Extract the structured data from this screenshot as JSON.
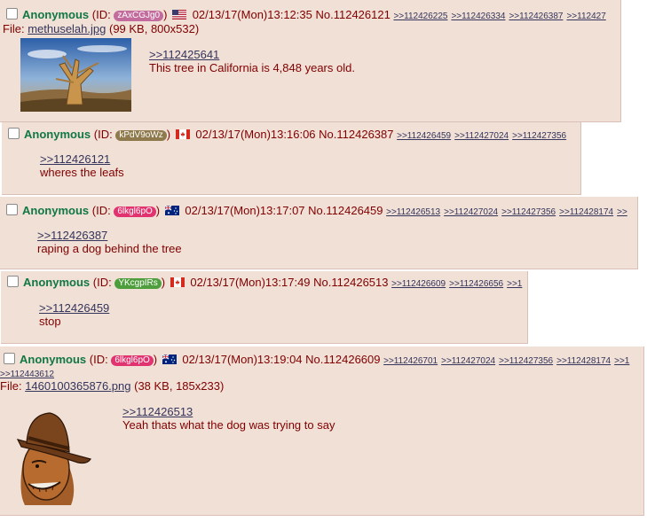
{
  "colors": {
    "post_bg": "#f0e0d6",
    "name": "#117743",
    "link": "#34345c",
    "text": "#800000",
    "page_bg": "#ffffff"
  },
  "posts": [
    {
      "name": "Anonymous",
      "id_prefix": "(ID: ",
      "id": "zAxCGJg0",
      "id_color": "#c26b9c",
      "id_suffix": ")",
      "flag_icon": "us-flag-icon",
      "datetime": "02/13/17(Mon)13:12:35",
      "postno": "No.112426121",
      "backlinks": [
        ">>112426225",
        ">>112426334",
        ">>112426387",
        ">>112427"
      ],
      "file_prefix": "File:",
      "file_name": "methuselah.jpg",
      "file_info": "(99 KB, 800x532)",
      "quote": ">>112425641",
      "text": "This tree in California is 4,848 years old.",
      "thumb_icon": "bristlecone-pine-photo"
    },
    {
      "name": "Anonymous",
      "id_prefix": "(ID: ",
      "id": "kPdV9oWz",
      "id_color": "#8e7a4c",
      "id_suffix": ")",
      "flag_icon": "canada-flag-icon",
      "datetime": "02/13/17(Mon)13:16:06",
      "postno": "No.112426387",
      "backlinks": [
        ">>112426459",
        ">>112427024",
        ">>112427356"
      ],
      "quote": ">>112426121",
      "text": "wheres the leafs"
    },
    {
      "name": "Anonymous",
      "id_prefix": "(ID: ",
      "id": "6lkgl6pO",
      "id_color": "#e0336f",
      "id_suffix": ")",
      "flag_icon": "australia-flag-icon",
      "datetime": "02/13/17(Mon)13:17:07",
      "postno": "No.112426459",
      "backlinks": [
        ">>112426513",
        ">>112427024",
        ">>112427356",
        ">>112428174",
        ">>"
      ],
      "quote": ">>112426387",
      "text": "raping a dog behind the tree"
    },
    {
      "name": "Anonymous",
      "id_prefix": "(ID: ",
      "id": "YKcgpIRs",
      "id_color": "#4f9e3d",
      "id_suffix": ")",
      "flag_icon": "canada-flag-icon",
      "datetime": "02/13/17(Mon)13:17:49",
      "postno": "No.112426513",
      "backlinks": [
        ">>112426609",
        ">>112426656",
        ">>1"
      ],
      "quote": ">>112426459",
      "text": "stop"
    },
    {
      "name": "Anonymous",
      "id_prefix": "(ID: ",
      "id": "6lkgl6pO",
      "id_color": "#e0336f",
      "id_suffix": ")",
      "flag_icon": "australia-flag-icon",
      "datetime": "02/13/17(Mon)13:19:04",
      "postno": "No.112426609",
      "backlinks": [
        ">>112426701",
        ">>112427024",
        ">>112427356",
        ">>112428174",
        ">>1"
      ],
      "backlinks2": [
        ">>112443612"
      ],
      "file_prefix": "File:",
      "file_name": "1460100365876.png",
      "file_info": "(38 KB, 185x233)",
      "quote": ">>112426513",
      "text": "Yeah thats what the dog was trying to say",
      "thumb_icon": "cowboy-hat-face-drawing"
    }
  ]
}
